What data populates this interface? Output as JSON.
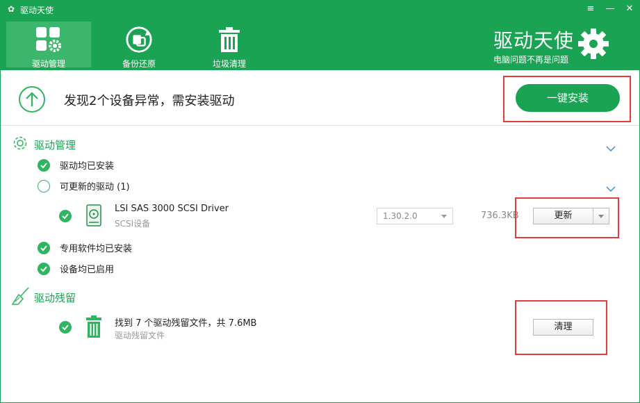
{
  "window": {
    "title": "驱动天使",
    "controls": {
      "menu": "≡",
      "minimize": "—",
      "close": "✕"
    }
  },
  "nav": {
    "tabs": [
      {
        "label": "驱动管理",
        "icon": "grid-gear-icon",
        "active": true
      },
      {
        "label": "备份还原",
        "icon": "restore-icon",
        "active": false
      },
      {
        "label": "垃圾清理",
        "icon": "trash-icon",
        "active": false
      }
    ]
  },
  "brand": {
    "name": "驱动天使",
    "slogan": "电脑问题不再是问题",
    "icon": "gear-icon"
  },
  "banner": {
    "message": "发现2个设备异常，需安装驱动",
    "install_label": "一键安装",
    "icon": "upload-arrow-icon"
  },
  "driver_management": {
    "title": "驱动管理",
    "items": [
      {
        "label": "驱动均已安装",
        "status": "ok"
      },
      {
        "label": "可更新的驱动 (1)",
        "status": "pending"
      },
      {
        "label": "专用软件均已安装",
        "status": "ok"
      },
      {
        "label": "设备均已启用",
        "status": "ok"
      }
    ],
    "driver": {
      "name": "LSI SAS 3000 SCSI Driver",
      "category": "SCSI设备",
      "version": "1.30.2.0",
      "size": "736.3KB",
      "update_label": "更新"
    }
  },
  "driver_residual": {
    "title": "驱动残留",
    "summary": "找到 7 个驱动残留文件，共 7.6MB",
    "sub": "驱动残留文件",
    "clean_label": "清理"
  },
  "colors": {
    "brand_green": "#1aa352",
    "check_green": "#2db560",
    "highlight_red": "#e23b3b"
  }
}
